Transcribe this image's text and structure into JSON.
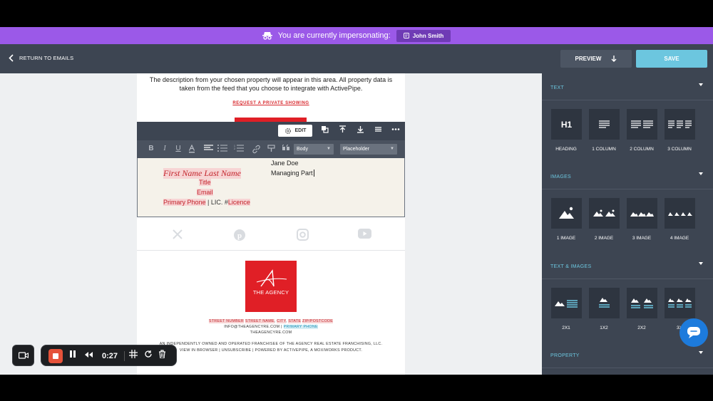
{
  "impersonation": {
    "message": "You are currently impersonating:",
    "user": "John Smith"
  },
  "toolbar": {
    "back_label": "RETURN TO EMAILS",
    "preview_label": "PREVIEW",
    "save_label": "SAVE"
  },
  "email": {
    "description": "The description from your chosen property will appear in this area. All property data is taken from the feed that you choose to integrate with ActivePipe.",
    "cta_label": "REQUEST A PRIVATE SHOWING",
    "editor": {
      "edit_label": "EDIT",
      "style_select": "Body",
      "placeholder_select": "Placeholder"
    },
    "signature": {
      "name": "First Name Last Name",
      "title": "Title",
      "email": "Email",
      "phone": "Primary Phone",
      "licence_sep": " | LIC. #",
      "licence": "Licence",
      "agent_name": "Jane Doe",
      "agent_role": "Managing Part"
    },
    "logo": {
      "mark": "A",
      "text": "THE AGENCY"
    },
    "footer": {
      "street_number": "STREET NUMBER",
      "street_name": "STREET NAME",
      "city": "CITY",
      "state": "STATE",
      "zip": "ZIP/POSTCODE",
      "email": "INFO@THEAGENCYRE.COM",
      "phone_sep": " | ",
      "phone": "PRIMARY PHONE",
      "website": "THEAGENCYRE.COM",
      "franchise": "AN INDEPENDENTLY OWNED AND OPERATED FRANCHISEE OF THE AGENCY REAL ESTATE FRANCHISING, LLC.",
      "links": "VIEW IN BROWSER  |  UNSUBSCRIBE | POWERED BY ACTIVEPIPE, A MOXIWORKS PRODUCT."
    }
  },
  "recorder": {
    "time": "0:27"
  },
  "sidebar": {
    "sections": [
      {
        "title": "TEXT",
        "tiles": [
          "HEADING",
          "1 COLUMN",
          "2 COLUMN",
          "3 COLUMN"
        ],
        "heading_glyph": "H1"
      },
      {
        "title": "IMAGES",
        "tiles": [
          "1 IMAGE",
          "2 IMAGE",
          "3 IMAGE",
          "4 IMAGE"
        ]
      },
      {
        "title": "TEXT & IMAGES",
        "tiles": [
          "2X1",
          "1X2",
          "2X2",
          "3X"
        ]
      },
      {
        "title": "PROPERTY"
      }
    ]
  },
  "colors": {
    "impersonation_bar": "#9b59e8",
    "toolbar": "#3d4552",
    "save_button": "#6cc6df",
    "brand_red": "#e01f26",
    "sidebar_accent": "#6cc6df",
    "chat_button": "#1d7bdc"
  }
}
